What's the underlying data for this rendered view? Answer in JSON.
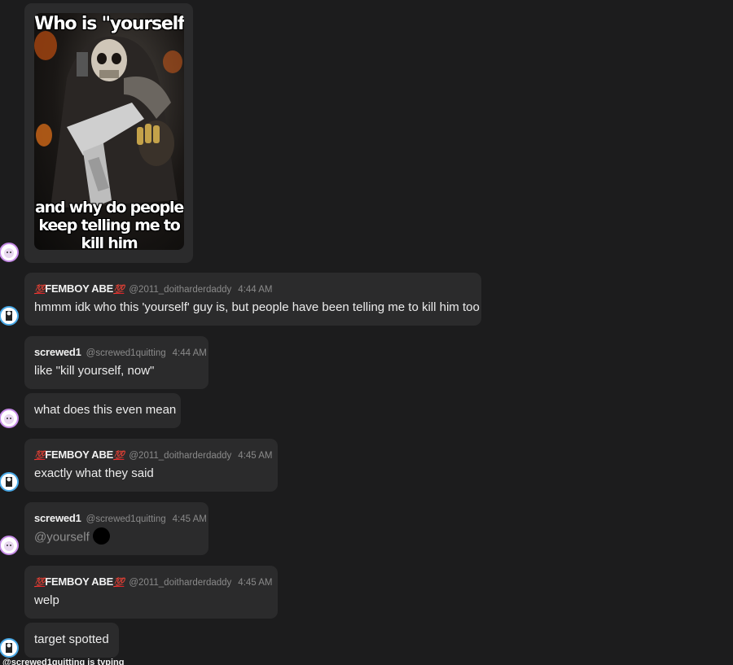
{
  "meme": {
    "top_caption": "Who is \"yourself\"",
    "bottom_caption_line1": "and why do people",
    "bottom_caption_line2": "keep telling me to",
    "bottom_caption_line3": "kill him"
  },
  "users": {
    "abe": {
      "prefix_emoji": "💯",
      "display_name": "FEMBOY ABE",
      "suffix_emoji": "💯",
      "handle": "@2011_doitharderdaddy"
    },
    "screwed": {
      "display_name": "screwed1",
      "handle": "@screwed1quitting"
    }
  },
  "messages": [
    {
      "time": "4:44 AM",
      "text": "hmmm idk who this 'yourself' guy is, but people have been telling me to kill him too"
    },
    {
      "time": "4:44 AM",
      "text": "like \"kill yourself, now\""
    },
    {
      "text": "what does this even mean"
    },
    {
      "time": "4:45 AM",
      "text": "exactly what they said"
    },
    {
      "time": "4:45 AM",
      "text": "@yourself"
    },
    {
      "time": "4:45 AM",
      "text": "welp"
    },
    {
      "text": "target spotted"
    }
  ],
  "typing_indicator": "@screwed1quitting is typing",
  "colors": {
    "background": "#1c1c1d",
    "bubble": "#2b2b2c",
    "emoji_red": "#e0242b",
    "muted": "#8a8a8a"
  }
}
